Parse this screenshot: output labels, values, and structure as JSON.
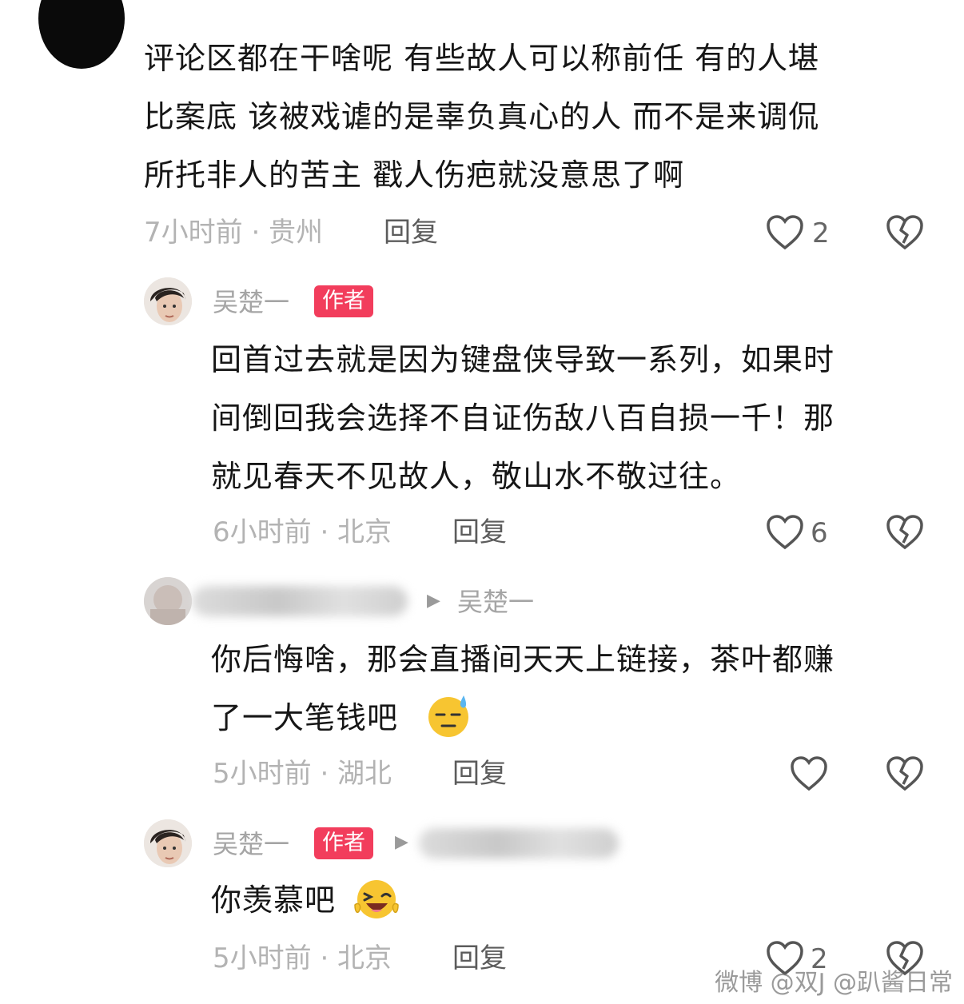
{
  "comments": [
    {
      "lines": [
        "评论区都在干啥呢 有些故人可以称前任 有的人堪",
        "比案底 该被戏谑的是辜负真心的人 而不是来调侃",
        "所托非人的苦主 戳人伤疤就没意思了啊"
      ],
      "meta": "7小时前 · 贵州",
      "reply": "回复",
      "likes": "2"
    },
    {
      "name": "吴楚一",
      "badge": "作者",
      "lines": [
        "回首过去就是因为键盘侠导致一系列，如果时",
        "间倒回我会选择不自证伤敌八百自损一千！那",
        "就见春天不见故人，敬山水不敬过往。"
      ],
      "meta": "6小时前 · 北京",
      "reply": "回复",
      "likes": "6"
    },
    {
      "reply_to": "吴楚一",
      "lines": [
        "你后悔啥，那会直播间天天上链接，茶叶都赚",
        "了一大笔钱吧"
      ],
      "emoji": "sweat-smile-emoji",
      "meta": "5小时前 · 湖北",
      "reply": "回复",
      "likes": ""
    },
    {
      "name": "吴楚一",
      "badge": "作者",
      "lines": [
        "你羡慕吧"
      ],
      "emoji": "laughing-wink-emoji",
      "meta": "5小时前 · 北京",
      "reply": "回复",
      "likes": "2"
    }
  ],
  "watermark": "微博 @双J @趴酱日常",
  "colors": {
    "badge": "#f23d5c",
    "meta": "#b3b3b3",
    "name": "#a5a5a5"
  }
}
